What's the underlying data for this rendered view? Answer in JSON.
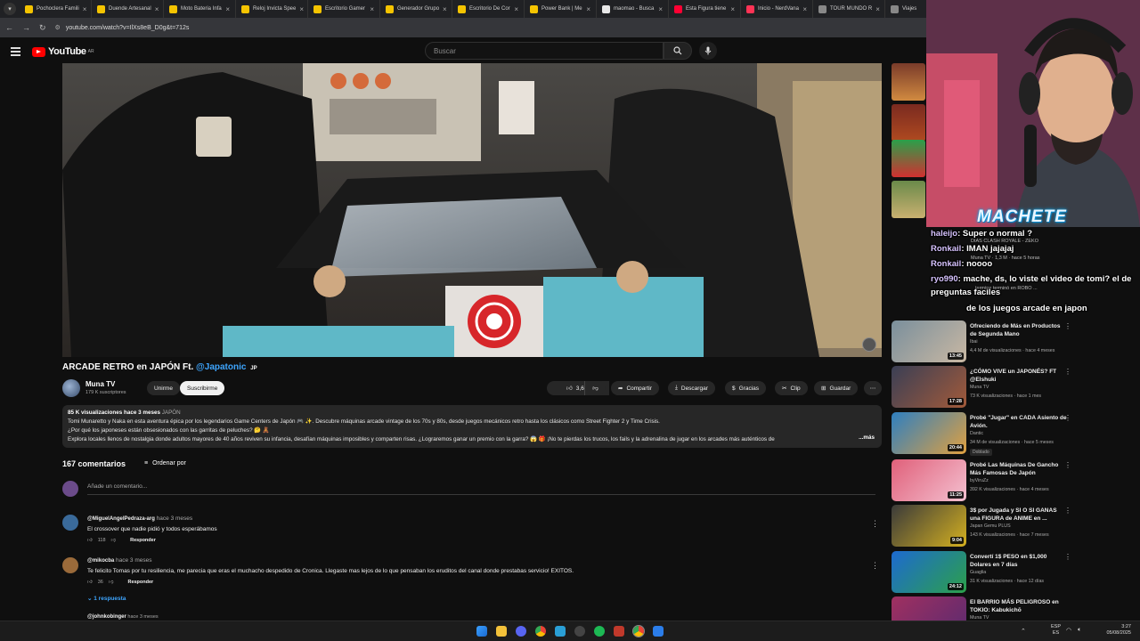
{
  "browser": {
    "tabs": [
      {
        "label": "Pochoclera Famili",
        "color": "#f5c400"
      },
      {
        "label": "Duende Artesanal",
        "color": "#f5c400"
      },
      {
        "label": "Moto Bateria Infa",
        "color": "#f5c400"
      },
      {
        "label": "Reloj Invicta Spee",
        "color": "#f5c400"
      },
      {
        "label": "Escritorio Gamer",
        "color": "#f5c400"
      },
      {
        "label": "Generador Grupo",
        "color": "#f5c400"
      },
      {
        "label": "Escritorio De Cor",
        "color": "#f5c400"
      },
      {
        "label": "Power Bank | Me",
        "color": "#f5c400"
      },
      {
        "label": "maomao - Busca",
        "color": "#e8e8e8"
      },
      {
        "label": "Esta Figura tiene",
        "color": "#ff0033"
      },
      {
        "label": "Inicio - NerdVana",
        "color": "#ff3355"
      },
      {
        "label": "TOUR MUNDO R",
        "color": "#888888"
      },
      {
        "label": "Viajes",
        "color": "#888888"
      }
    ],
    "url": "youtube.com/watch?v=IlXs8eB_D0g&t=712s"
  },
  "youtube": {
    "logo_text": "YouTube",
    "logo_region": "AR",
    "search_placeholder": "Buscar"
  },
  "video": {
    "title": "ARCADE RETRO en JAPÓN Ft.",
    "mention": "@Japatonic",
    "mention_flag": "JP",
    "channel_name": "Muna TV",
    "channel_subs": "179 K suscriptores",
    "join_label": "Unirme",
    "subscribe_label": "Suscribirme",
    "likes": "3,6 K",
    "share_label": "Compartir",
    "download_label": "Descargar",
    "thanks_label": "Gracias",
    "clip_label": "Clip",
    "save_label": "Guardar",
    "description": {
      "views": "85 K visualizaciones",
      "age": "hace 3 meses",
      "tag": "JAPÓN",
      "line1": "Tomi Munaretto y Naka en esta aventura épica por los legendarios Game Centers de Japón 🎮 ✨. Descubre máquinas arcade vintage de los 70s y 80s, desde juegos mecánicos retro hasta los clásicos como Street Fighter 2 y Time Crisis.",
      "line2": "¿Por qué los japoneses están obsesionados con las garritas de peluches? 🤔 🧸",
      "line3": "Explora locales llenos de nostalgia donde adultos mayores de 40 años reviven su infancia, desafían máquinas imposibles y comparten risas. ¿Lograremos ganar un premio con la garra? 😱 🎁 ¡No te pierdas los trucos, los fails y la adrenalina de jugar en los arcades más auténticos de",
      "more": "...más"
    }
  },
  "comments": {
    "count_label": "167 comentarios",
    "sort_label": "Ordenar por",
    "add_placeholder": "Añade un comentario...",
    "items": [
      {
        "author": "@MiguelAngelPedraza-arg",
        "ago": "hace 3 meses",
        "text": "El crossover que nadie pidió y todos esperábamos",
        "likes": "118",
        "reply": "Responder"
      },
      {
        "author": "@mikocba",
        "ago": "hace 3 meses",
        "text": "Te felicito Tomas por tu resiliencia, me parecia que eras el muchacho despedido de Cronica. Llegaste mas lejos de lo que pensaban los eruditos del canal donde prestabas servicio! EXITOS.",
        "likes": "36",
        "reply": "Responder"
      }
    ],
    "replies_label": "1 respuesta",
    "next_author": "@johnkobinger",
    "next_ago": "hace 3 meses"
  },
  "sidebar": {
    "items": [
      {
        "title": "Ofreciendo de Más en Productos de Segunda Mano",
        "channel": "Ibai",
        "views": "4,4 M de visualizaciones · hace 4 meses",
        "duration": "13:45",
        "colors": [
          "#7a8f9c",
          "#c9b8a3"
        ]
      },
      {
        "title": "¿CÓMO VIVE un JAPONÉS? FT @Elshuki",
        "channel": "Muna TV",
        "views": "73 K visualizaciones · hace 1 mes",
        "duration": "17:28",
        "colors": [
          "#3a3f55",
          "#a25a3a"
        ]
      },
      {
        "title": "Probé \"Jugar\" en CADA Asiento de Avión.",
        "channel": "Dantic",
        "views": "34 M de visualizaciones · hace 5 meses",
        "duration": "20:44",
        "colors": [
          "#2e7fc0",
          "#e0a040"
        ],
        "badge": "Doblado"
      },
      {
        "title": "Probé Las Máquinas De Gancho Más Famosas De Japón",
        "channel": "byViruZz",
        "views": "392 K visualizaciones · hace 4 meses",
        "duration": "11:25",
        "colors": [
          "#e0607a",
          "#f4c0d0"
        ]
      },
      {
        "title": "3$ por Jugada y SI O SI GANAS una FIGURA de ANIME en ...",
        "channel": "Japan Gemu PLUS",
        "views": "143 K visualizaciones · hace 7 meses",
        "duration": "9:04",
        "colors": [
          "#3a3a3a",
          "#d4b020"
        ]
      },
      {
        "title": "Convertí 1$ PESO en $1,000 Dolares en 7 días",
        "channel": "Guaglia",
        "views": "31 K visualizaciones · hace 12 días",
        "duration": "24:12",
        "colors": [
          "#1d6ad0",
          "#2ca04a"
        ]
      },
      {
        "title": "El BARRIO MÁS PELIGROSO en TOKIO: Kabukichō",
        "channel": "Muna TV",
        "views": "",
        "duration": "",
        "colors": [
          "#a03060",
          "#5a2a70"
        ]
      }
    ]
  },
  "overlay": {
    "brand": "MACHETE",
    "chat": [
      {
        "user": "haleijo",
        "text": ": Super o normal ?"
      },
      {
        "user": "Ronkail",
        "text": ": IMAN jajajaj"
      },
      {
        "user": "Ronkail",
        "text": ": noooo"
      },
      {
        "user": "ryo990",
        "text": ": mache, ds, lo viste el video de tomi? el de"
      },
      {
        "user": "",
        "text": "preguntas faciles"
      },
      {
        "user": "",
        "text": "de los juegos arcade en japon"
      }
    ],
    "under_text": [
      "DIAS CLASH ROYALE - ZEKO",
      "Muna TV · 1,3 M · hace 5 horas",
      "termine terminó en ROBO ..."
    ]
  },
  "taskbar": {
    "lang": "ESP",
    "lang_sub": "ES",
    "time": "3:27",
    "date": "05/08/2025"
  }
}
